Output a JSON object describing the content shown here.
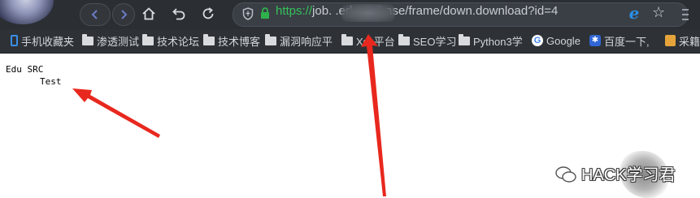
{
  "browser": {
    "url_scheme": "https://",
    "url_rest": "job.          .edu.cn/base/frame/down.download?id=4",
    "bookmarks": [
      "手机收藏夹",
      "渗透测试",
      "技术论坛",
      "技术博客",
      "漏洞响应平",
      "Xss平台",
      "SEO学习",
      "Python3学",
      "Google",
      "百度一下,",
      "采籍"
    ]
  },
  "page": {
    "line1": "Edu SRC",
    "line2": "Test"
  },
  "watermark": {
    "text": "HACK学习君"
  },
  "colors": {
    "toolbar": "#2b2f33",
    "url_scheme": "#35c15b",
    "arrow": "#e8281e"
  }
}
